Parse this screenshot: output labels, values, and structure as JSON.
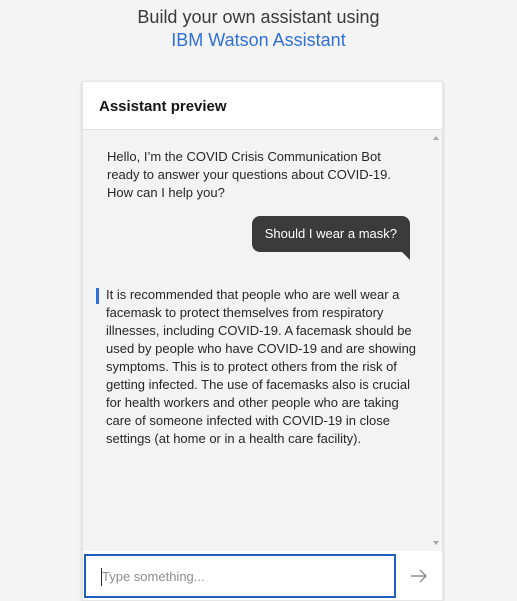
{
  "heading": {
    "line1": "Build your own assistant using",
    "brand": "IBM Watson Assistant"
  },
  "preview": {
    "title": "Assistant preview"
  },
  "chat": {
    "greeting": "Hello, I’m the COVID Crisis Communication Bot ready to answer your questions about COVID-19. How can I help you?",
    "user_message": "Should I wear a mask?",
    "answer": "It is recommended that people who are well wear a facemask to protect themselves from respiratory illnesses, including COVID-19. A facemask should be used by people who have COVID-19 and are showing symptoms. This is to protect others from the risk of getting infected. The use of facemasks also is crucial for health workers and other people who are taking care of someone infected with COVID-19 in close settings (at home or in a health care facility)."
  },
  "input": {
    "placeholder": "Type something..."
  },
  "colors": {
    "brand_link": "#2f6fd8",
    "user_bubble": "#3b3b3b",
    "input_focus": "#1f5fbf",
    "answer_bar": "#2f6fd8"
  },
  "icons": {
    "send": "arrow-right-icon",
    "scroll_up": "scroll-up-arrow-icon",
    "scroll_down": "scroll-down-arrow-icon"
  }
}
